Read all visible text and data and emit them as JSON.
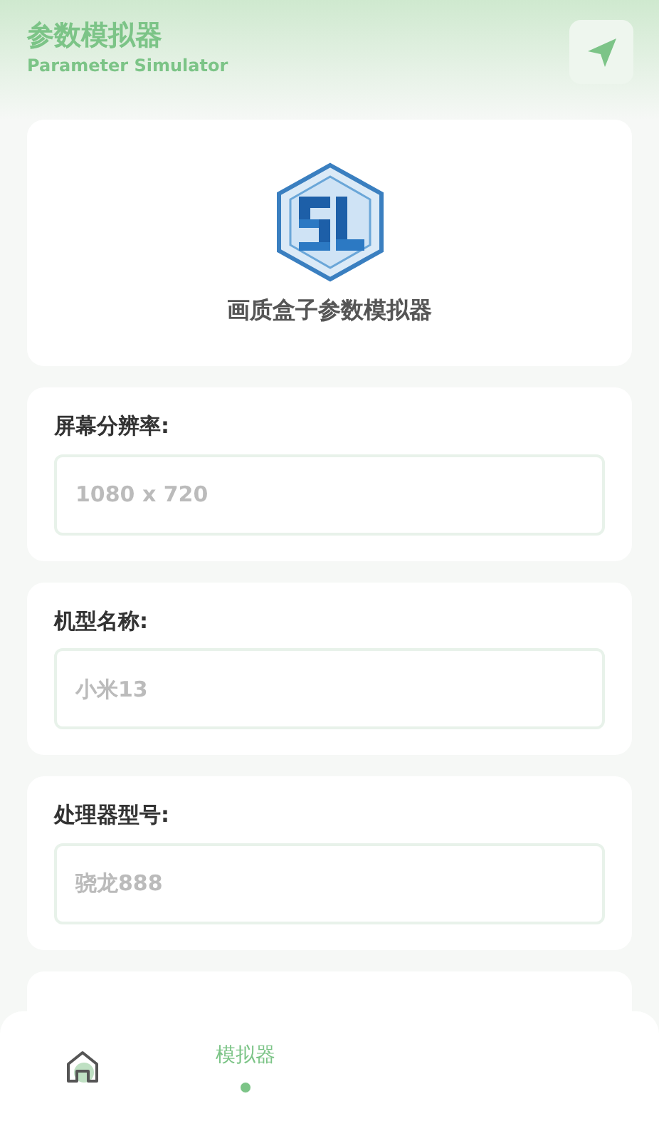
{
  "header": {
    "title": "参数模拟器",
    "subtitle": "Parameter Simulator"
  },
  "logo_card": {
    "caption": "画质盒子参数模拟器"
  },
  "fields": [
    {
      "label": "屏幕分辨率:",
      "placeholder": "1080 x 720"
    },
    {
      "label": "机型名称:",
      "placeholder": "小米13"
    },
    {
      "label": "处理器型号:",
      "placeholder": "骁龙888"
    }
  ],
  "nav": [
    {
      "kind": "icon",
      "selected": false
    },
    {
      "kind": "text",
      "label": "模拟器",
      "selected": true
    }
  ]
}
